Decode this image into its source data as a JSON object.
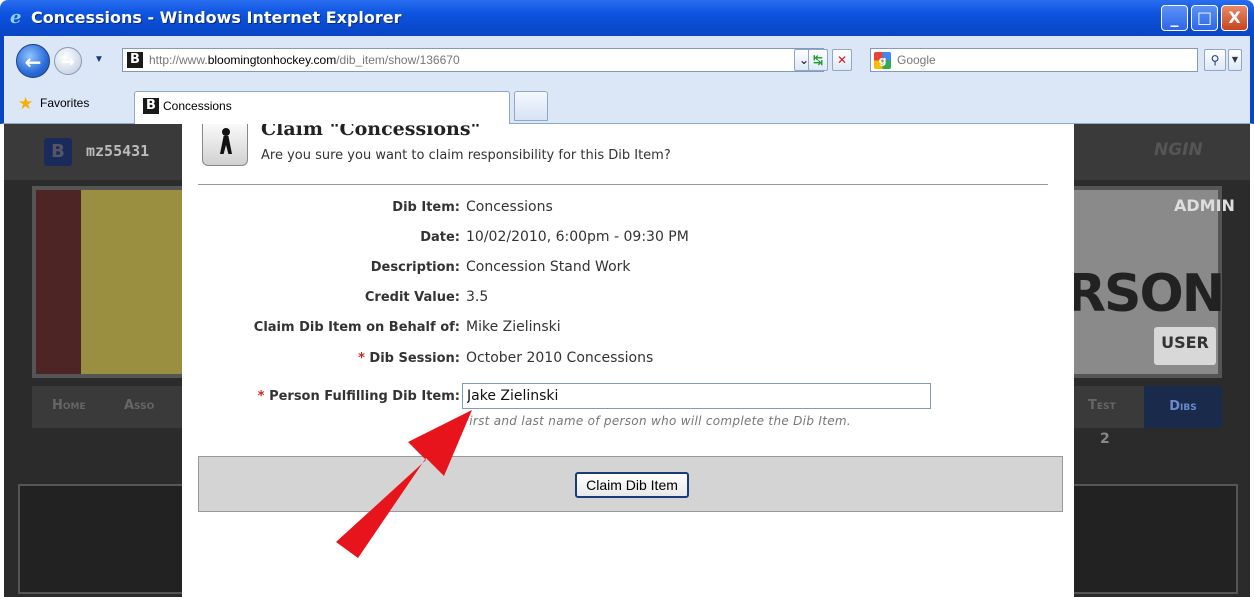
{
  "window": {
    "title": "Concessions - Windows Internet Explorer",
    "minimize": "_",
    "maximize": "□",
    "close": "X"
  },
  "address_bar": {
    "url_prefix": "http://www.",
    "url_host": "bloomingtonhockey.com",
    "url_path": "/dib_item/show/136670",
    "search_placeholder": "Google"
  },
  "tabs": {
    "favorites_label": "Favorites",
    "active_tab_label": "Concessions"
  },
  "background": {
    "username": "mz55431",
    "ngin_logo": "NGIN",
    "admin_label": "ADMIN",
    "user_mode_label": "USER",
    "sponsor_text": "RSON",
    "nav_items": [
      "Home",
      "Asso",
      "Test"
    ],
    "dibs_tab": "Dibs",
    "dibs_badge": "2"
  },
  "modal": {
    "title": "Claim \"Concessions\"",
    "subtitle": "Are you sure you want to claim responsibility for this Dib Item?",
    "fields": {
      "dib_item": {
        "label": "Dib Item:",
        "value": "Concessions"
      },
      "date": {
        "label": "Date:",
        "value": "10/02/2010, 6:00pm - 09:30 PM"
      },
      "description": {
        "label": "Description:",
        "value": "Concession Stand Work"
      },
      "credit_value": {
        "label": "Credit Value:",
        "value": "3.5"
      },
      "behalf_of": {
        "label": "Claim Dib Item on Behalf of:",
        "value": "Mike Zielinski"
      },
      "dib_session": {
        "label": "Dib Session:",
        "value": "October 2010 Concessions"
      },
      "person_fulfilling": {
        "label": "Person Fulfilling Dib Item:",
        "value": "Jake Zielinski"
      }
    },
    "required_marker": "*",
    "helper_text": "First and last name of person who will complete the Dib Item.",
    "claim_button": "Claim Dib Item"
  },
  "annotation": {
    "arrow_color": "#e8141c"
  }
}
